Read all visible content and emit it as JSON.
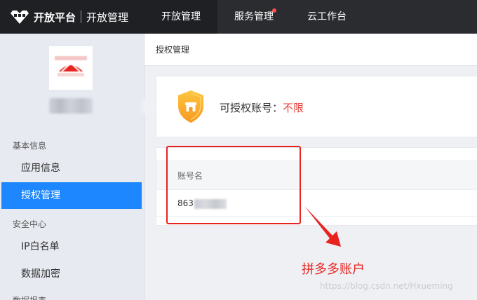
{
  "brand": {
    "platform": "开放平台",
    "product": "开放管理"
  },
  "nav": {
    "items": [
      {
        "label": "开放管理",
        "active": true
      },
      {
        "label": "服务管理",
        "badge_dot": true
      },
      {
        "label": "云工作台"
      }
    ]
  },
  "sidebar": {
    "sections": [
      {
        "title": "基本信息",
        "items": [
          {
            "label": "应用信息"
          },
          {
            "label": "授权管理",
            "active": true
          }
        ]
      },
      {
        "title": "安全中心",
        "items": [
          {
            "label": "IP白名单"
          },
          {
            "label": "数据加密"
          }
        ]
      },
      {
        "title": "数据报表"
      }
    ]
  },
  "breadcrumb": "授权管理",
  "auth": {
    "label": "可授权账号：",
    "value": "不限"
  },
  "table": {
    "header": "账号名",
    "rows": [
      {
        "account_visible": "863"
      }
    ]
  },
  "annotation": {
    "text": "拼多多账户"
  },
  "watermark": "https://blog.csdn.net/Hxueming",
  "colors": {
    "accent": "#1d87ff",
    "topbar": "#2b2c30",
    "annotation": "#e8231f",
    "alert": "#e6413a"
  }
}
